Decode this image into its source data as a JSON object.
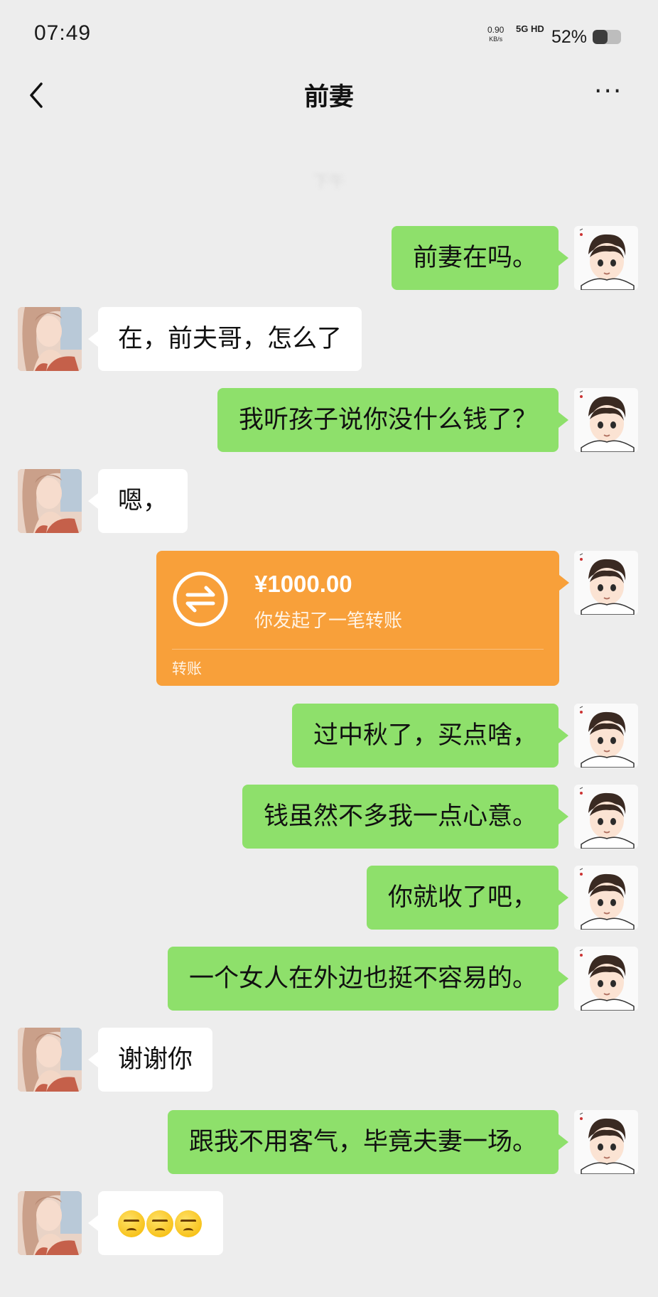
{
  "status_bar": {
    "time": "07:49",
    "net_speed": "0.90",
    "net_unit": "KB/s",
    "signal": "5G HD",
    "battery": "52%",
    "battery_level": 0.52
  },
  "header": {
    "title": "前妻",
    "more": "···"
  },
  "timestamp": "下午",
  "messages": [
    {
      "from": "me",
      "text": "前妻在吗。"
    },
    {
      "from": "her",
      "text": "在，前夫哥，怎么了"
    },
    {
      "from": "me",
      "text": "我听孩子说你没什么钱了？"
    },
    {
      "from": "her",
      "text": "嗯，"
    },
    {
      "from": "me",
      "type": "transfer",
      "amount": "¥1000.00",
      "desc": "你发起了一笔转账",
      "label": "转账"
    },
    {
      "from": "me",
      "text": "过中秋了，买点啥，"
    },
    {
      "from": "me",
      "text": "钱虽然不多我一点心意。"
    },
    {
      "from": "me",
      "text": "你就收了吧，"
    },
    {
      "from": "me",
      "text": "一个女人在外边也挺不容易的。"
    },
    {
      "from": "her",
      "text": "谢谢你"
    },
    {
      "from": "me",
      "text": "跟我不用客气，毕竟夫妻一场。"
    },
    {
      "from": "her",
      "type": "emoji",
      "emoji": [
        "angry-face",
        "angry-face",
        "angry-face"
      ]
    }
  ],
  "colors": {
    "background": "#ededed",
    "my_bubble": "#8ee06b",
    "her_bubble": "#ffffff",
    "transfer": "#f8a03a"
  }
}
